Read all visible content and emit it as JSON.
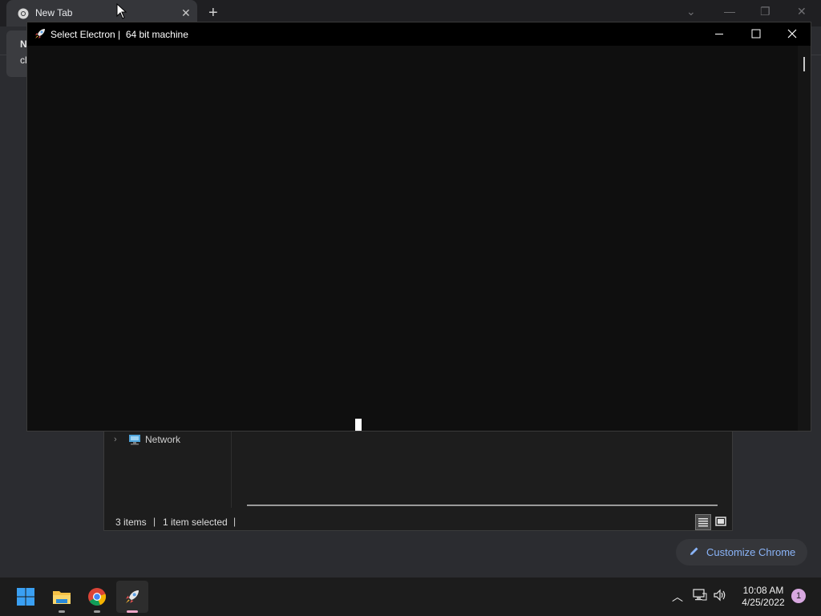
{
  "chrome": {
    "tab_title": "New Tab",
    "notification_lines": [
      "N",
      "cl"
    ],
    "customize_label": "Customize Chrome"
  },
  "explorer": {
    "nav_network_label": "Network",
    "status_items": "3 items",
    "status_selected": "1 item selected"
  },
  "electron": {
    "window_title": "Select Electron |  64 bit machine"
  },
  "taskbar": {
    "clock_time": "10:08 AM",
    "clock_date": "4/25/2022",
    "notification_count": "1"
  },
  "colors": {
    "chrome_accent": "#8ab4f8",
    "start_blue": "#3aa0f3",
    "active_indicator": "#f0a6c8"
  },
  "icons": [
    "chrome-favicon-icon",
    "plus-icon",
    "close-icon",
    "network-icon",
    "rocket-icon",
    "minimize-icon",
    "maximize-icon",
    "windows-start-icon",
    "file-explorer-icon",
    "chrome-icon",
    "chevron-up-icon",
    "network-tray-icon",
    "volume-icon",
    "pencil-icon",
    "details-view-icon",
    "thumbnail-view-icon"
  ]
}
